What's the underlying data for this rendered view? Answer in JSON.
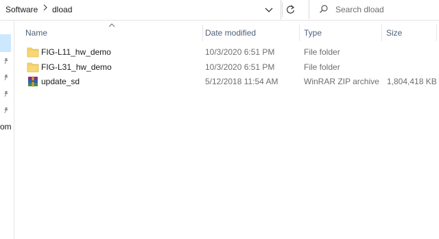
{
  "address": {
    "breadcrumbs": [
      "Software",
      "dload"
    ],
    "separator": ">"
  },
  "search": {
    "placeholder": "Search dload"
  },
  "navpane": {
    "partial_label": "om"
  },
  "columns": {
    "name": "Name",
    "date": "Date modified",
    "type": "Type",
    "size": "Size"
  },
  "files": [
    {
      "name": "FIG-L11_hw_demo",
      "date": "10/3/2020 6:51 PM",
      "type": "File folder",
      "size": "",
      "icon": "folder-icon"
    },
    {
      "name": "FIG-L31_hw_demo",
      "date": "10/3/2020 6:51 PM",
      "type": "File folder",
      "size": "",
      "icon": "folder-icon"
    },
    {
      "name": "update_sd",
      "date": "5/12/2018 11:54 AM",
      "type": "WinRAR ZIP archive",
      "size": "1,804,418 KB",
      "icon": "winrar-archive-icon"
    }
  ],
  "colors": {
    "folder": "#f8d775",
    "selection": "#cce8ff",
    "header_text": "#4c607a"
  }
}
